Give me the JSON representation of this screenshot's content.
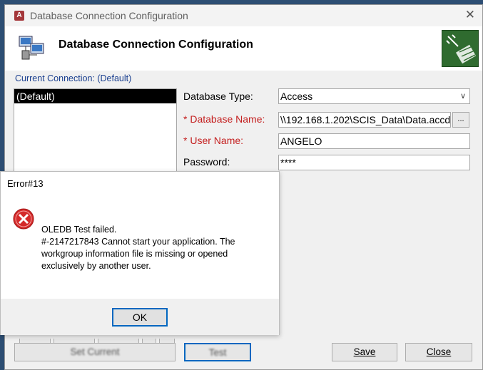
{
  "window": {
    "title": "Database Connection Configuration",
    "app_icon": "A"
  },
  "header": {
    "title": "Database Connection Configuration"
  },
  "current_connection_label": "Current Connection: (Default)",
  "connections": [
    "(Default)"
  ],
  "form": {
    "db_type": {
      "label": "Database Type:",
      "value": "Access"
    },
    "db_name": {
      "req": "*",
      "label": "Database Name:",
      "value": "\\\\192.168.1.202\\SCIS_Data\\Data.accdb"
    },
    "user_name": {
      "req": "*",
      "label": "User Name:",
      "value": "ANGELO"
    },
    "password": {
      "label": "Password:",
      "value": "****"
    },
    "browse_label": "..."
  },
  "buttons": {
    "set_current": "Set Current",
    "test": "Test",
    "save": "Save",
    "close": "Close"
  },
  "error_dialog": {
    "title": "Error#13",
    "line1": "OLEDB Test failed.",
    "line2": "#-2147217843 Cannot start your application. The workgroup information file is missing or opened exclusively by another user.",
    "ok": "OK"
  },
  "colors": {
    "required": "#c41f1f",
    "link_blue": "#1a3f8f",
    "focus": "#0067c0",
    "error_red": "#d42a2a"
  }
}
